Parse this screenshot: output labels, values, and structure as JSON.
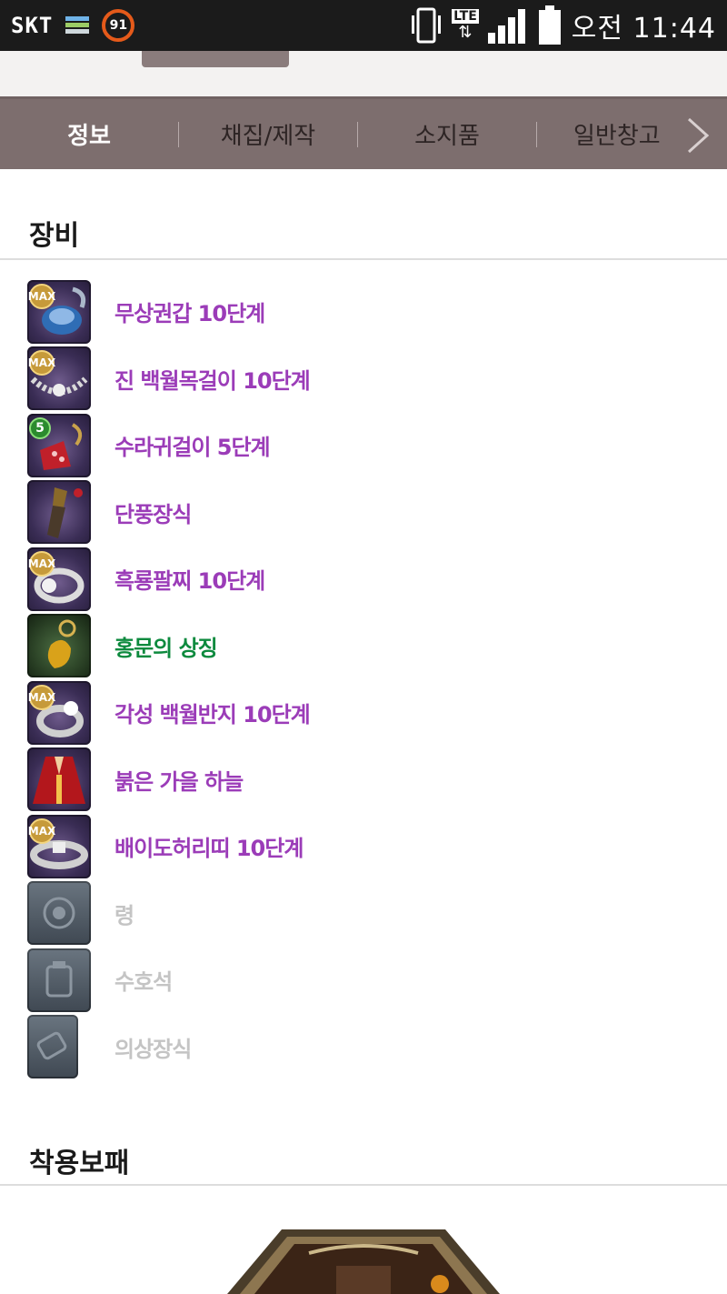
{
  "status_bar": {
    "carrier": "SKT",
    "battery_badge": "91",
    "network": "LTE",
    "time": "오전 11:44"
  },
  "tabs": [
    {
      "label": "정보",
      "active": true
    },
    {
      "label": "채집/제작",
      "active": false
    },
    {
      "label": "소지품",
      "active": false
    },
    {
      "label": "일반창고",
      "active": false
    }
  ],
  "sections": {
    "equipment_title": "장비",
    "badge_title": "착용보패"
  },
  "equipment": [
    {
      "name": "무상권갑 10단계",
      "badge": "MAX",
      "color": "purple",
      "icon": "gauntlet-icon"
    },
    {
      "name": "진 백월목걸이 10단계",
      "badge": "MAX",
      "color": "purple",
      "icon": "necklace-icon"
    },
    {
      "name": "수라귀걸이 5단계",
      "badge": "5",
      "color": "purple",
      "icon": "earring-icon"
    },
    {
      "name": "단풍장식",
      "badge": "",
      "color": "purple",
      "icon": "ornament-icon"
    },
    {
      "name": "흑룡팔찌 10단계",
      "badge": "MAX",
      "color": "purple",
      "icon": "bracelet-icon"
    },
    {
      "name": "홍문의 상징",
      "badge": "",
      "color": "green",
      "icon": "pendant-icon"
    },
    {
      "name": "각성 백월반지 10단계",
      "badge": "MAX",
      "color": "purple",
      "icon": "ring-icon"
    },
    {
      "name": "붉은 가을 하늘",
      "badge": "",
      "color": "purple",
      "icon": "costume-icon"
    },
    {
      "name": "배이도허리띠 10단계",
      "badge": "MAX",
      "color": "purple",
      "icon": "belt-icon"
    },
    {
      "name": "령",
      "badge": "",
      "color": "gray",
      "icon": "spirit-slot-icon"
    },
    {
      "name": "수호석",
      "badge": "",
      "color": "gray",
      "icon": "guardian-stone-slot-icon"
    },
    {
      "name": "의상장식",
      "badge": "",
      "color": "gray",
      "icon": "costume-ornament-slot-icon"
    }
  ],
  "colors": {
    "tab_bar": "#7d6e6e",
    "item_purple": "#9b3cb8",
    "item_green": "#0d8a3e",
    "item_gray": "#c4c4c4"
  }
}
